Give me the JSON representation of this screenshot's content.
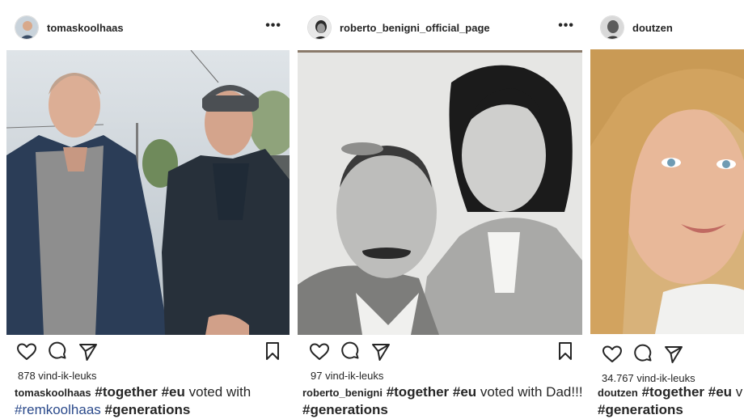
{
  "posts": [
    {
      "username": "tomaskoolhaas",
      "more_label": "•••",
      "likes": "878 vind-ik-leuks",
      "caption": {
        "user": "tomaskoolhaas",
        "tag1": "#together",
        "tag2": "#eu",
        "text1": "voted with",
        "mention": "#remkoolhaas",
        "tag3": "#generations"
      }
    },
    {
      "username": "roberto_benigni_official_page",
      "more_label": "•••",
      "likes": "97 vind-ik-leuks",
      "caption": {
        "user": "roberto_benigni",
        "tag1": "#together",
        "tag2": "#eu",
        "text1": "voted with Dad!!!",
        "tag3": "#generations"
      }
    },
    {
      "username": "doutzen",
      "likes": "34.767 vind-ik-leuks",
      "caption": {
        "user": "doutzen",
        "tag1": "#together",
        "tag2": "#eu",
        "text1": "v",
        "tag3": "#generations"
      }
    }
  ],
  "icons": {
    "like": "heart-icon",
    "comment": "comment-bubble-icon",
    "share": "paper-plane-icon",
    "save": "bookmark-icon"
  },
  "colors": {
    "text": "#262626",
    "link": "#2b4a8b"
  }
}
